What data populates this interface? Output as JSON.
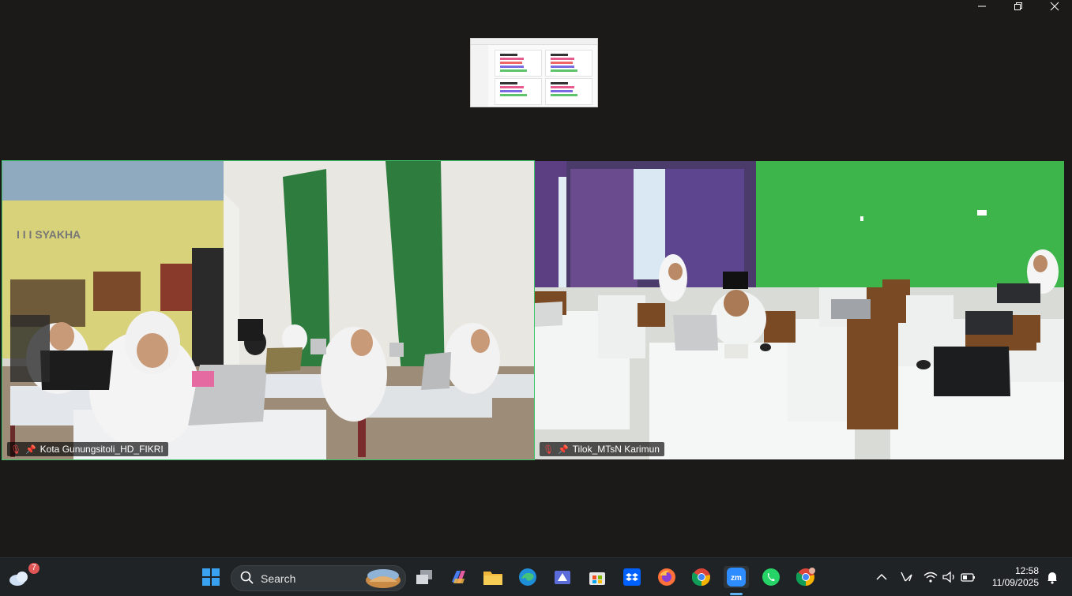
{
  "screen_share": {
    "title": "screen share preview"
  },
  "participants": [
    {
      "name": "Kota Gunungsitoli_HD_FIKRI",
      "active_speaker": true,
      "muted": true,
      "pinned": true
    },
    {
      "name": "Tilok_MTsN Karimun",
      "active_speaker": false,
      "muted": true,
      "pinned": true
    }
  ],
  "colors": {
    "active_border": "#3ec56a",
    "muted_mic": "#e64545"
  },
  "taskbar": {
    "weather_badge": "7",
    "search_placeholder": "Search",
    "apps": [
      "start-icon",
      "task-view-icon",
      "copilot-icon",
      "file-explorer-icon",
      "edge-icon",
      "store-app-icon",
      "microsoft-store-icon",
      "dropbox-icon",
      "firefox-icon",
      "chrome-icon",
      "zoom-icon",
      "whatsapp-icon",
      "chrome-profile-icon"
    ],
    "time": "12:58",
    "date": "11/09/2025"
  }
}
